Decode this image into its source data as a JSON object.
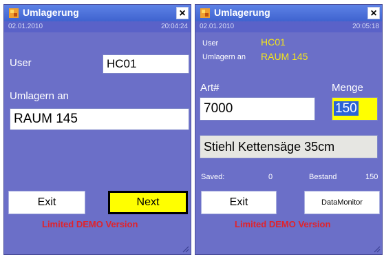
{
  "left": {
    "title": "Umlagerung",
    "close_label": "×",
    "date": "02.01.2010",
    "time": "20:04:24",
    "user_label": "User",
    "user_value": "HC01",
    "umlagern_label": "Umlagern an",
    "umlagern_value": "RAUM 145",
    "exit_label": "Exit",
    "next_label": "Next",
    "demo_text": "Limited DEMO Version"
  },
  "right": {
    "title": "Umlagerung",
    "close_label": "×",
    "date": "02.01.2010",
    "time": "20:05:18",
    "user_label": "User",
    "user_value": "HC01",
    "umlagern_label": "Umlagern an",
    "umlagern_value": "RAUM 145",
    "art_label": "Art#",
    "menge_label": "Menge",
    "art_value": "7000",
    "menge_value": "150",
    "description": "Stiehl Kettensäge 35cm",
    "saved_label": "Saved:",
    "saved_value": "0",
    "bestand_label": "Bestand",
    "bestand_value": "150",
    "exit_label": "Exit",
    "datamonitor_label": "DataMonitor",
    "demo_text": "Limited DEMO Version"
  },
  "colors": {
    "background": "#6b6fc8",
    "titlebar": "#4a6fdb",
    "yellow_label": "#f5e61a",
    "next_button": "#ffff00",
    "demo_red": "#e0232c"
  },
  "icons": [
    "app-icon",
    "close-icon",
    "resize-grip-icon"
  ]
}
